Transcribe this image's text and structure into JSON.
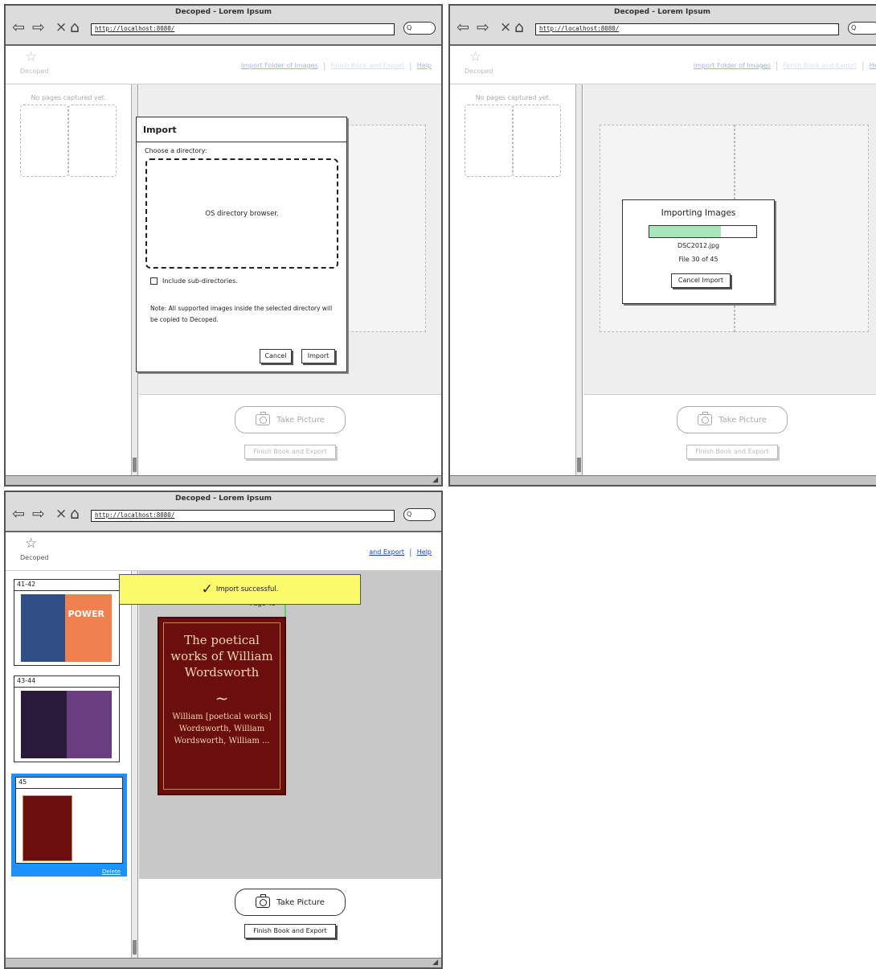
{
  "browser": {
    "title": "Decoped - Lorem Ipsum",
    "url": "http://localhost:8080/",
    "search_text": "Q"
  },
  "app": {
    "name": "Decoped",
    "links": {
      "import_folder": "Import Folder of Images",
      "finish_export": "Finish Book and Export",
      "finish_export_partial": "and Export",
      "help": "Help"
    }
  },
  "sidebar": {
    "empty_message": "No pages captured yet."
  },
  "main": {
    "take_picture": "Take Picture",
    "finish_book": "Finish Book and Export"
  },
  "import_dialog": {
    "title": "Import",
    "choose_label": "Choose a directory:",
    "browser_placeholder": "OS directory browser.",
    "include_subdirs": "Include sub-directories.",
    "note": "Note: All supported images inside the selected directory will be copied to Decoped.",
    "cancel": "Cancel",
    "import": "Import"
  },
  "progress_dialog": {
    "title": "Importing Images",
    "progress": 0.667,
    "filename": "DSC2012.jpg",
    "count": "File 30 of 45",
    "cancel": "Cancel Import"
  },
  "success": {
    "toast": "Import successful.",
    "thumbnails": [
      {
        "label": "41-42",
        "right_cover_text": "POWER"
      },
      {
        "label": "43-44"
      },
      {
        "label": "45",
        "action": "Delete"
      }
    ],
    "page_label": "Page 45",
    "book": {
      "title": "The poetical works of William Wordsworth",
      "tilde": "~",
      "author": "William [poetical works] Wordsworth, William Wordsworth, William ..."
    }
  },
  "colors": {
    "highlight": "#1e90ff",
    "toast": "#fafa6b",
    "progress_fill": "#a9e6b9",
    "book_cover": "#6b0e0e"
  }
}
